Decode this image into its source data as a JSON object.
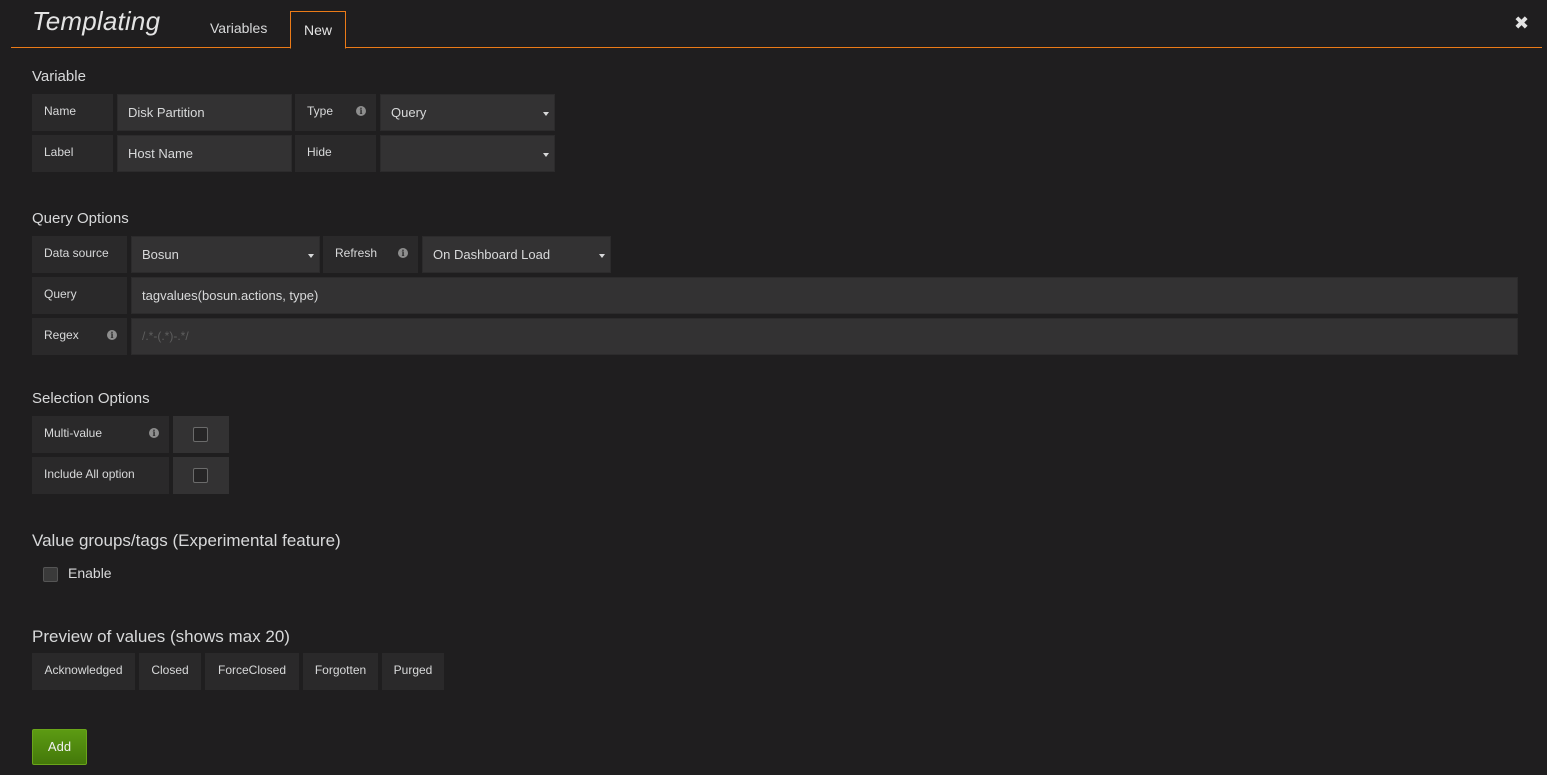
{
  "header": {
    "title": "Templating",
    "tabs": [
      {
        "label": "Variables"
      },
      {
        "label": "New"
      }
    ],
    "close_icon": "close-icon"
  },
  "variable": {
    "section_title": "Variable",
    "name_label": "Name",
    "name_value": "Disk Partition",
    "type_label": "Type",
    "type_value": "Query",
    "label_label": "Label",
    "label_value": "Host Name",
    "hide_label": "Hide",
    "hide_value": ""
  },
  "query_options": {
    "section_title": "Query Options",
    "datasource_label": "Data source",
    "datasource_value": "Bosun",
    "refresh_label": "Refresh",
    "refresh_value": "On Dashboard Load",
    "query_label": "Query",
    "query_value": "tagvalues(bosun.actions, type)",
    "regex_label": "Regex",
    "regex_placeholder": "/.*-(.*)-.*/"
  },
  "selection_options": {
    "section_title": "Selection Options",
    "multivalue_label": "Multi-value",
    "multivalue_checked": false,
    "include_all_label": "Include All option",
    "include_all_checked": false
  },
  "value_groups": {
    "section_title": "Value groups/tags (Experimental feature)",
    "enable_label": "Enable",
    "enable_checked": false
  },
  "preview": {
    "section_title": "Preview of values (shows max 20)",
    "values": [
      "Acknowledged",
      "Closed",
      "ForceClosed",
      "Forgotten",
      "Purged"
    ]
  },
  "actions": {
    "add_label": "Add"
  },
  "colors": {
    "accent": "#eb7b18",
    "background": "#1f1e1f",
    "add_button": "#538c10"
  }
}
